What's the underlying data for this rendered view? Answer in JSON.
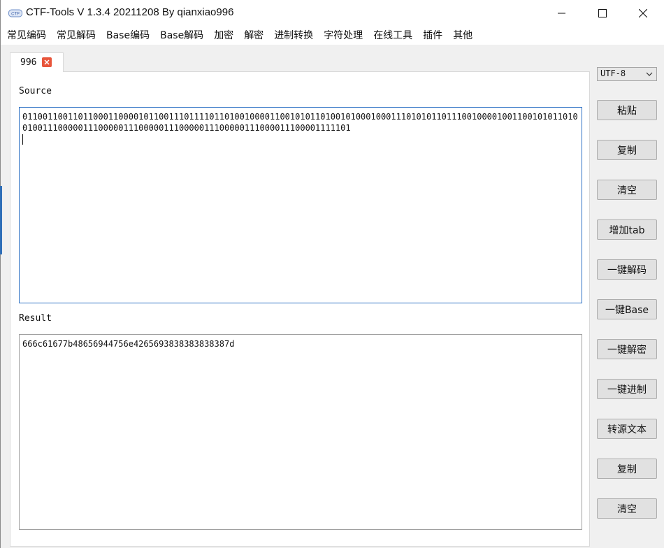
{
  "window": {
    "title": "CTF-Tools V 1.3.4 20211208 By qianxiao996"
  },
  "menu": {
    "items": [
      "常见编码",
      "常见解码",
      "Base编码",
      "Base解码",
      "加密",
      "解密",
      "进制转换",
      "字符处理",
      "在线工具",
      "插件",
      "其他"
    ]
  },
  "tab": {
    "label": "996"
  },
  "source": {
    "label": "Source",
    "text": "0110011001101100011000010110011101111011010010000110010101101001010001000111010101101110010000100110010101101001001110000011100000111000001110000011100000111000011100001111101"
  },
  "result": {
    "label": "Result",
    "text": "666c61677b48656944756e4265693838383838387d"
  },
  "encoding": {
    "selected": "UTF-8"
  },
  "buttons": {
    "paste": "粘贴",
    "copy_source": "复制",
    "clear_source": "清空",
    "add_tab": "增加tab",
    "one_click_decode": "一键解码",
    "one_click_base": "一键Base",
    "one_click_decrypt": "一键解密",
    "one_click_radix": "一键进制",
    "to_source_text": "转源文本",
    "copy_result": "复制",
    "clear_result": "清空"
  }
}
